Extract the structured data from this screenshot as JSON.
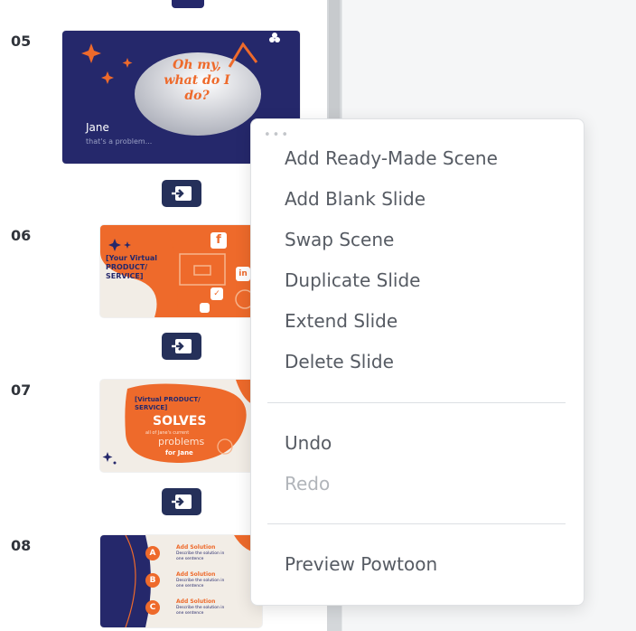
{
  "slides": [
    {
      "number": "05",
      "bubble_text": "Oh my, what do I do?",
      "name": "Jane",
      "caption": "that's a problem..."
    },
    {
      "number": "06",
      "product_text": "[Your Virtual PRODUCT/ SERVICE]"
    },
    {
      "number": "07",
      "heading": "[Virtual PRODUCT/ SERVICE]",
      "big_word": "SOLVES",
      "line1": "all of Jane's current",
      "line2": "problems",
      "line3": "for Jane"
    },
    {
      "number": "08",
      "solutions": [
        {
          "letter": "A",
          "title": "Add Solution",
          "desc": "Describe the solution in one sentence"
        },
        {
          "letter": "B",
          "title": "Add Solution",
          "desc": "Describe the solution in one sentence"
        },
        {
          "letter": "C",
          "title": "Add Solution",
          "desc": "Describe the solution in one sentence"
        }
      ]
    }
  ],
  "context_menu": {
    "dots": "•••",
    "items": [
      {
        "label": "Add Ready-Made Scene",
        "enabled": true
      },
      {
        "label": "Add Blank Slide",
        "enabled": true
      },
      {
        "label": "Swap Scene",
        "enabled": true
      },
      {
        "label": "Duplicate Slide",
        "enabled": true
      },
      {
        "label": "Extend Slide",
        "enabled": true
      },
      {
        "label": "Delete Slide",
        "enabled": true
      }
    ],
    "history": [
      {
        "label": "Undo",
        "enabled": true
      },
      {
        "label": "Redo",
        "enabled": false
      }
    ],
    "preview": {
      "label": "Preview Powtoon",
      "enabled": true
    }
  },
  "colors": {
    "navy": "#25286b",
    "orange": "#ee6a2b",
    "cream": "#f2ede6",
    "menu_text": "#565b63",
    "menu_disabled": "#b1b5ba"
  },
  "icons": {
    "transition": "transition-icon",
    "facebook": "facebook-icon",
    "linkedin": "linkedin-icon",
    "twitter": "twitter-icon",
    "instagram": "instagram-icon"
  }
}
